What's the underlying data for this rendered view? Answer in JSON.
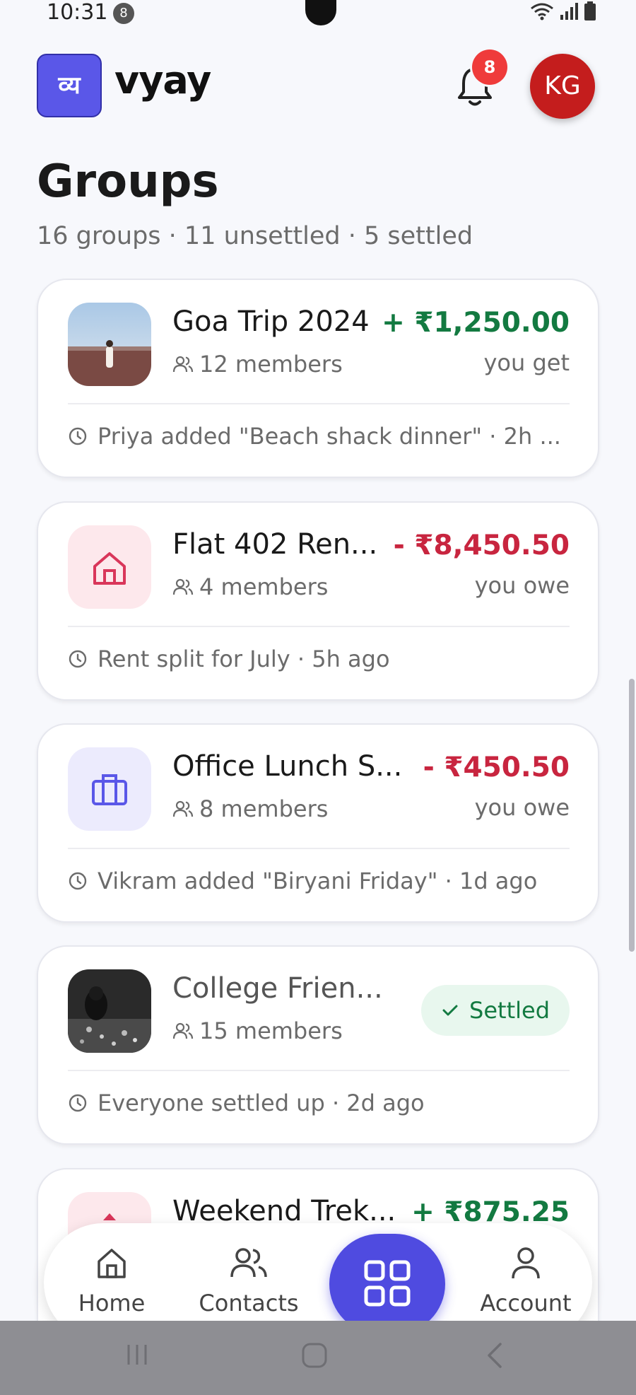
{
  "status": {
    "time": "10:31",
    "badge": "8"
  },
  "app": {
    "logo_glyph": "व्य",
    "name": "vyay"
  },
  "header": {
    "notification_count": "8",
    "avatar_initials": "KG"
  },
  "page": {
    "title": "Groups",
    "subtitle": "16 groups · 11 unsettled · 5 settled"
  },
  "groups": [
    {
      "name": "Goa Trip 2024",
      "members": "12 members",
      "amount": "+ ₹1,250.00",
      "amount_caption": "you get",
      "activity": "Priya added \"Beach shack dinner\" · 2h ...",
      "status": "positive",
      "icon": "photo-beach"
    },
    {
      "name": "Flat 402 Ren...",
      "members": "4 members",
      "amount": "- ₹8,450.50",
      "amount_caption": "you owe",
      "activity": "Rent split for July · 5h ago",
      "status": "negative",
      "icon": "home-icon"
    },
    {
      "name": "Office Lunch S...",
      "members": "8 members",
      "amount": "- ₹450.50",
      "amount_caption": "you owe",
      "activity": "Vikram added \"Biryani Friday\" · 1d ago",
      "status": "negative",
      "icon": "briefcase-icon"
    },
    {
      "name": "College Frien...",
      "members": "15 members",
      "settled_label": "Settled",
      "activity": "Everyone settled up · 2d ago",
      "status": "settled",
      "icon": "photo-group"
    },
    {
      "name": "Weekend Trek...",
      "amount": "+ ₹875.25",
      "status": "positive",
      "icon": "trek-icon"
    }
  ],
  "nav": {
    "home": "Home",
    "contacts": "Contacts",
    "account": "Account"
  },
  "colors": {
    "accent": "#4f4be0",
    "positive": "#137a41",
    "negative": "#c8253f",
    "avatar": "#c41d1d"
  }
}
